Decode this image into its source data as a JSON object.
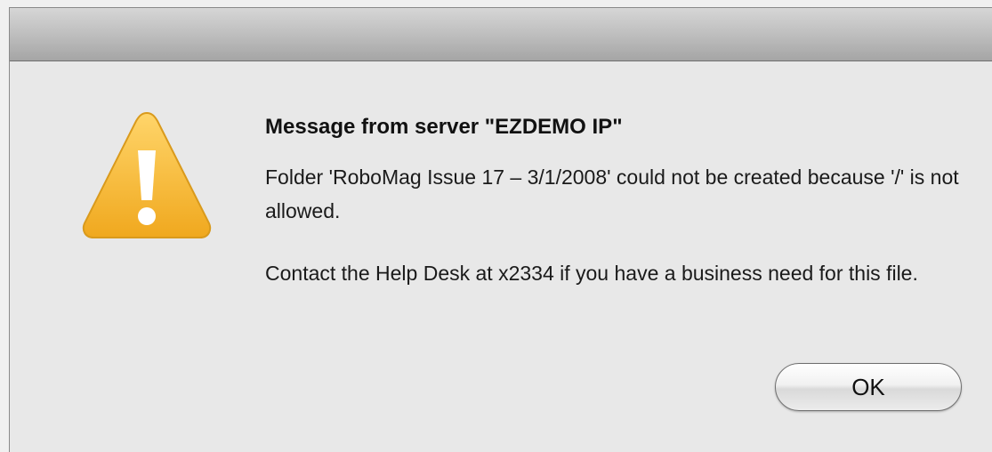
{
  "dialog": {
    "title": "Message from server \"EZDEMO IP\"",
    "paragraph_1": "Folder 'RoboMag Issue 17 –  3/1/2008' could not be created because '/' is not allowed.",
    "paragraph_2": "Contact the Help Desk at x2334 if you have a business need for this file.",
    "ok_label": "OK",
    "icon": "warning-icon"
  },
  "colors": {
    "warning_fill": "#f5b92e",
    "warning_mark": "#ffffff"
  }
}
